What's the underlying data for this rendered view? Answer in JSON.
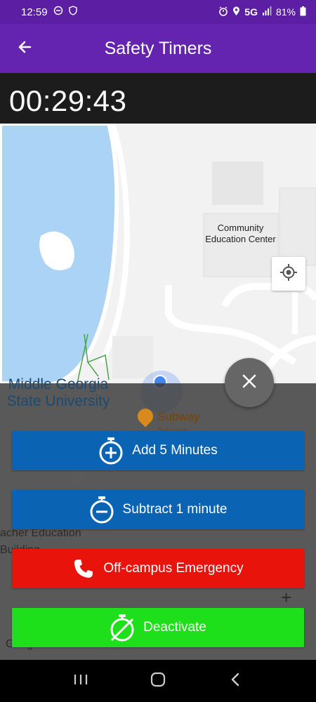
{
  "status_bar": {
    "time": "12:59",
    "network": "5G",
    "battery": "81%"
  },
  "header": {
    "title": "Safety Timers"
  },
  "timer": {
    "value": "00:29:43"
  },
  "map": {
    "labels": {
      "community_center": "Community Education Center",
      "university": "Middle Georgia State University",
      "subway": "Subway",
      "subway_sub": "Takeout",
      "teacher_building": "acher Education Building",
      "google": "Google"
    }
  },
  "actions": {
    "add": "Add 5 Minutes",
    "subtract": "Subtract 1 minute",
    "emergency": "Off-campus Emergency",
    "deactivate": "Deactivate"
  },
  "colors": {
    "header": "#6424b0",
    "blue_button": "#0b63b4",
    "red_button": "#e8140c",
    "green_button": "#1ddf1a"
  },
  "icons": [
    "back-arrow-icon",
    "my-location-icon",
    "close-icon",
    "timer-plus-icon",
    "timer-minus-icon",
    "phone-icon",
    "timer-off-icon"
  ]
}
